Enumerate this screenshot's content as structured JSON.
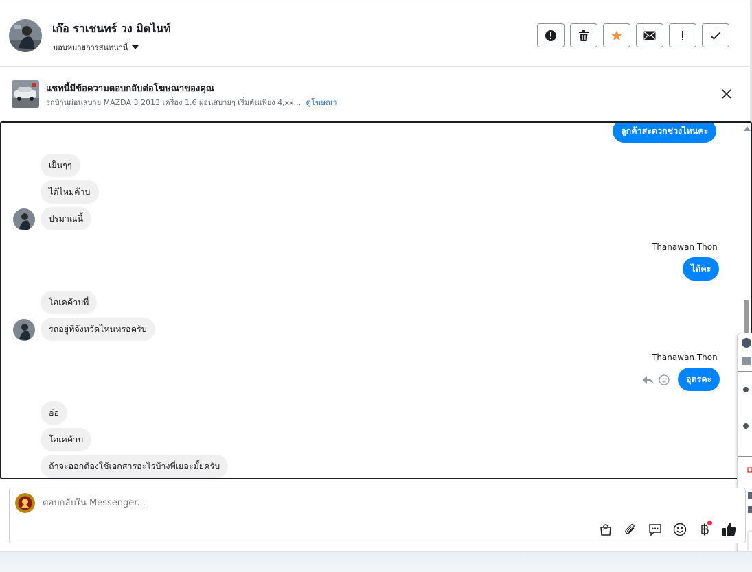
{
  "header": {
    "contact_name": "เก๊อ ราเชนทร์ วง มิตไนท์",
    "assign_label": "มอบหมายการสนทนานี้",
    "actions": [
      {
        "name": "spam-button",
        "icon": "alert-circle-icon"
      },
      {
        "name": "delete-button",
        "icon": "trash-icon"
      },
      {
        "name": "star-button",
        "icon": "star-icon",
        "color": "#f7923b"
      },
      {
        "name": "mark-unread-button",
        "icon": "envelope-icon"
      },
      {
        "name": "follow-up-button",
        "icon": "exclamation-icon"
      },
      {
        "name": "mark-done-button",
        "icon": "checkmark-icon"
      }
    ]
  },
  "ad": {
    "title": "แชทนี้มีข้อความตอบกลับต่อโฆษณาของคุณ",
    "subtitle": "รถบ้านผ่อนสบาย MAZDA 3 2013 เครื่อง 1.6 ผ่อนสบายๆ เริ่มต้นเพียง 4,xx...",
    "view_ad_link": "ดูโฆษณา"
  },
  "messages": {
    "out_1": "ลูกค้าสะดวกช่วงไหนคะ",
    "in_1": "เย็นๆๆ",
    "in_2": "ได้ไหมค้าบ",
    "in_3": "ปรมาณนี้",
    "sender_1": "Thanawan Thon",
    "out_2": "ได้คะ",
    "in_4": "โอเคค้าบพี่",
    "in_5": "รถอยู่ที่จังหวัดไหนหรอครับ",
    "sender_2": "Thanawan Thon",
    "out_3": "อุดรคะ",
    "in_6": "อ่อ",
    "in_7": "โอเคค้าบ",
    "in_8": "ถ้าจะออกต้องใช้เอกสารอะไรบ้างพี่เยอะมั้ยครับ"
  },
  "composer": {
    "placeholder": "ตอบกลับใน Messenger...",
    "tools": [
      "shopping-bag-icon",
      "paperclip-icon",
      "saved-reply-icon",
      "emoji-icon",
      "baht-icon",
      "thumbs-up-icon"
    ]
  },
  "colors": {
    "outgoing_bubble": "#0084ff",
    "incoming_bubble": "#f0f0f0",
    "link": "#216fdb",
    "star": "#f7923b"
  }
}
